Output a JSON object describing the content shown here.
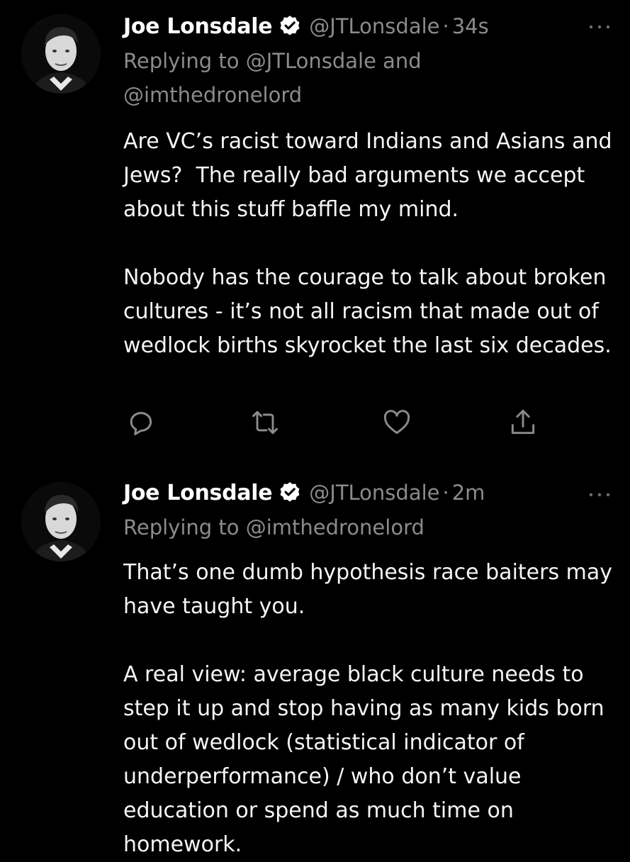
{
  "tweets": [
    {
      "author": {
        "name": "Joe Lonsdale",
        "handle": "@JTLonsdale",
        "verified": true
      },
      "time": "34s",
      "replying_to": "Replying to @JTLonsdale and @imthedronelord",
      "text": "Are VC’s racist toward Indians and Asians and Jews?  The really bad arguments we accept about this stuff baffle my mind.\n\nNobody has the courage to talk about broken cultures - it’s not all racism that made out of wedlock births skyrocket the last six decades.",
      "icons": {
        "reply": "comment-icon",
        "retweet": "retweet-icon",
        "like": "heart-icon",
        "share": "share-icon",
        "more": "more-options-icon"
      }
    },
    {
      "author": {
        "name": "Joe Lonsdale",
        "handle": "@JTLonsdale",
        "verified": true
      },
      "time": "2m",
      "replying_to": "Replying to @imthedronelord",
      "text": "That’s one dumb hypothesis race baiters may have taught you.\n\nA real view: average black culture needs to step it up and stop having as many kids born out of wedlock (statistical indicator of underperformance) / who don’t value education or spend as much time on homework.",
      "icons": {
        "more": "more-options-icon"
      }
    }
  ],
  "separator": "·",
  "colors": {
    "background": "#000000",
    "primary_text": "#f5f5f5",
    "secondary_text": "#8b8b8b",
    "verified_badge": "#ffffff"
  }
}
